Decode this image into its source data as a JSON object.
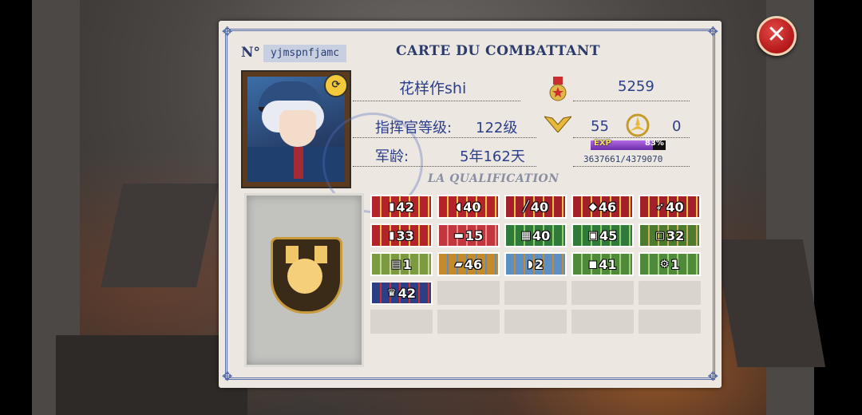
{
  "card": {
    "title": "CARTE DU COMBATTANT",
    "no_label": "N°",
    "player_id": "yjmspnfjamc",
    "name": "花样作shi",
    "score": "5259",
    "level_label": "指挥官等级:",
    "level_value": "122级",
    "age_label": "军龄:",
    "age_value": "5年162天",
    "rank_value_1": "55",
    "rank_value_2": "0",
    "exp": {
      "label": "EXP",
      "percent_text": "83%",
      "fraction": 0.83,
      "numbers": "3637661/4379070"
    },
    "qualification_title": "LA QUALIFICATION"
  },
  "medals": [
    {
      "value": "42",
      "icon": "bottle-icon",
      "color": "#b5232a",
      "stripe": "#e5c34b"
    },
    {
      "value": "40",
      "icon": "shell-icon",
      "color": "#b5232a",
      "stripe": "#e5c34b"
    },
    {
      "value": "40",
      "icon": "rifle-icon",
      "color": "#a3202a",
      "stripe": "#e5c34b"
    },
    {
      "value": "46",
      "icon": "bullet-icon",
      "color": "#a3202a",
      "stripe": "#e5c34b"
    },
    {
      "value": "40",
      "icon": "rocket-icon",
      "color": "#a3202a",
      "stripe": "#e5c34b"
    },
    {
      "value": "33",
      "icon": "bottle-icon",
      "color": "#b5232a",
      "stripe": "#e5c34b"
    },
    {
      "value": "15",
      "icon": "battery-icon",
      "color": "#c2363d",
      "stripe": "#ef8a8a"
    },
    {
      "value": "40",
      "icon": "map-icon",
      "color": "#2f7a3a",
      "stripe": "#8fcf6b"
    },
    {
      "value": "45",
      "icon": "window-icon",
      "color": "#2f7a3a",
      "stripe": "#8fcf6b"
    },
    {
      "value": "32",
      "icon": "frame-icon",
      "color": "#4c7a2e",
      "stripe": "#c7b25e"
    },
    {
      "value": "1",
      "icon": "document-icon",
      "color": "#7c9a3f",
      "stripe": "#c8d69a"
    },
    {
      "value": "46",
      "icon": "tank-icon",
      "color": "#c58a2a",
      "stripe": "#5d8fc2"
    },
    {
      "value": "2",
      "icon": "ship-icon",
      "color": "#5d8fc2",
      "stripe": "#c58a2a"
    },
    {
      "value": "41",
      "icon": "vehicle-icon",
      "color": "#4e8a3a",
      "stripe": "#9fcf7a"
    },
    {
      "value": "1",
      "icon": "gear-icon",
      "color": "#4e8a3a",
      "stripe": "#9fcf7a"
    },
    {
      "value": "42",
      "icon": "trophy-icon",
      "color": "#2c3f86",
      "stripe": "#c92f2f"
    }
  ],
  "close_label": "✕"
}
